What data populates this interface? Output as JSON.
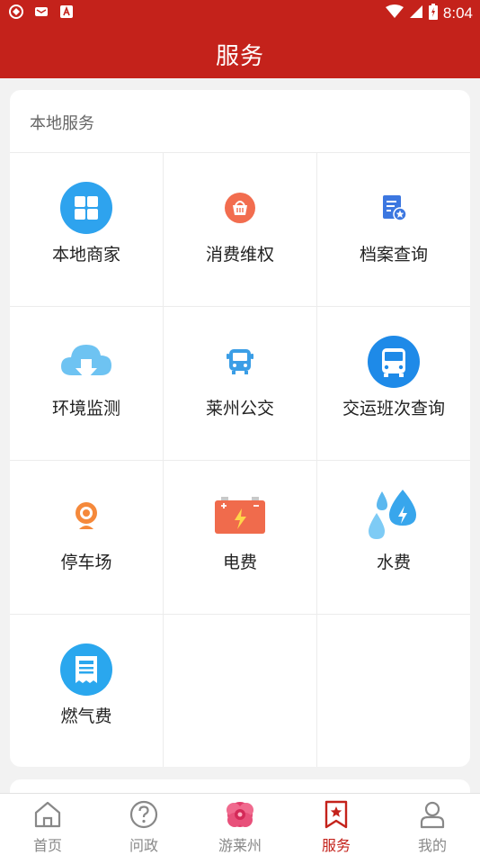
{
  "status_bar": {
    "time": "8:04",
    "icons": [
      "vpn-icon",
      "mail-icon",
      "a-icon",
      "wifi-icon",
      "signal-icon",
      "battery-icon"
    ]
  },
  "header": {
    "title": "服务"
  },
  "section": {
    "title": "本地服务"
  },
  "services": [
    {
      "label": "本地商家",
      "icon": "grid-apps-icon",
      "color": "#2ea3ee"
    },
    {
      "label": "消费维权",
      "icon": "basket-icon",
      "color": "#f26d4f"
    },
    {
      "label": "档案查询",
      "icon": "document-star-icon",
      "color": "#3c77e0"
    },
    {
      "label": "环境监测",
      "icon": "cloud-download-icon",
      "color": "#6ec3f2"
    },
    {
      "label": "莱州公交",
      "icon": "bus-small-icon",
      "color": "#3b9ee6"
    },
    {
      "label": "交运班次查询",
      "icon": "bus-circle-icon",
      "color": "#1e8ae8"
    },
    {
      "label": "停车场",
      "icon": "webcam-icon",
      "color": "#f5893b"
    },
    {
      "label": "电费",
      "icon": "battery-charge-icon",
      "color": "#f06b4c"
    },
    {
      "label": "水费",
      "icon": "water-drops-icon",
      "color": "#38a6ec"
    },
    {
      "label": "燃气费",
      "icon": "receipt-icon",
      "color": "#2aa7ee"
    }
  ],
  "tabs": [
    {
      "label": "首页",
      "icon": "home-icon"
    },
    {
      "label": "问政",
      "icon": "question-icon"
    },
    {
      "label": "游莱州",
      "icon": "flower-icon"
    },
    {
      "label": "服务",
      "icon": "bookmark-star-icon",
      "active": true
    },
    {
      "label": "我的",
      "icon": "user-icon"
    }
  ],
  "colors": {
    "brand": "#c4221b",
    "tab_inactive": "#888888"
  }
}
